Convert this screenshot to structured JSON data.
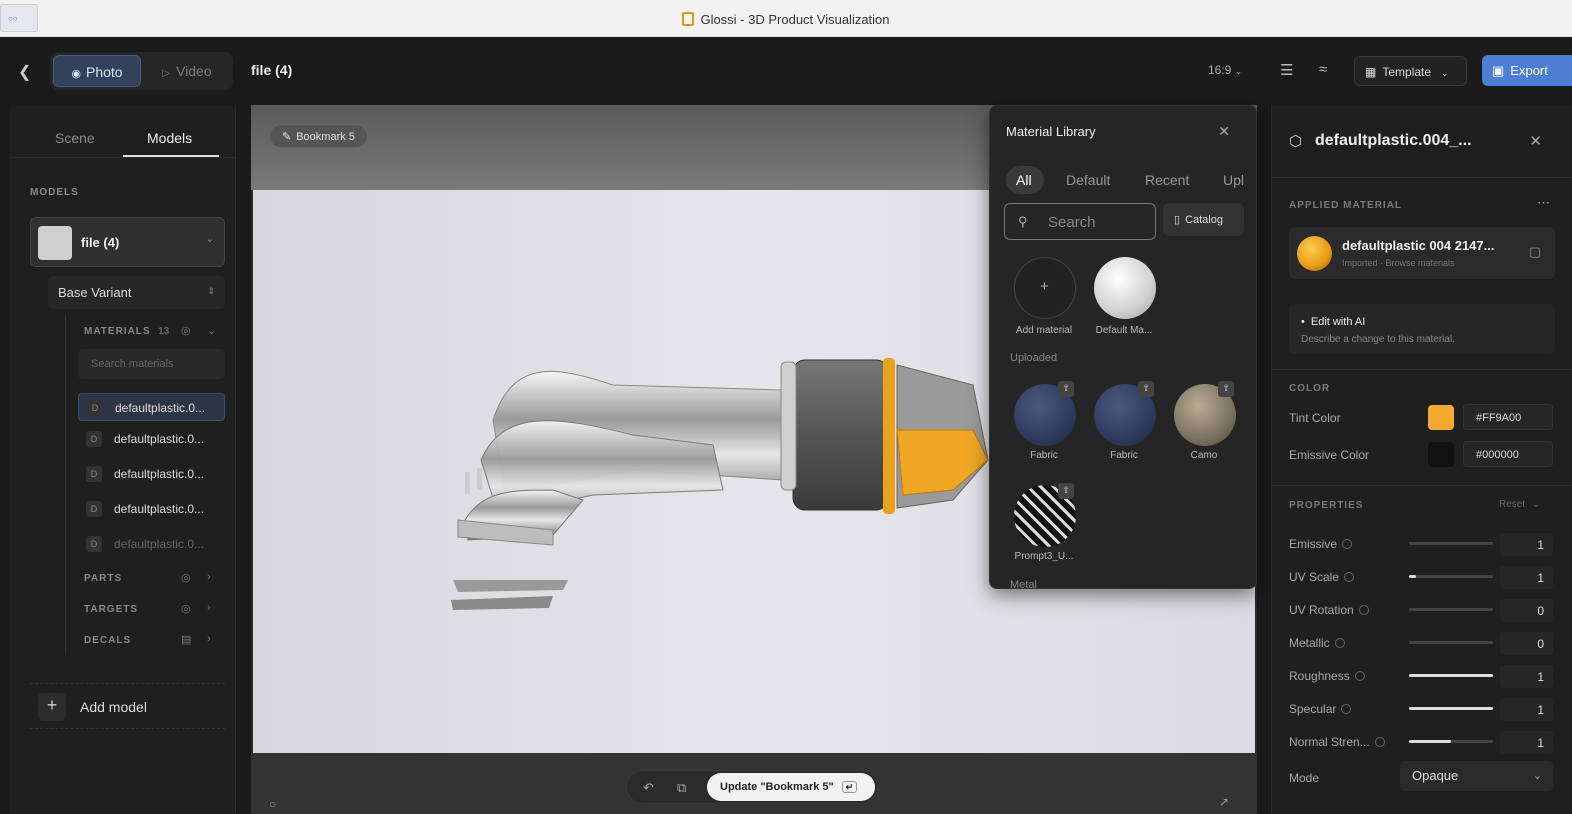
{
  "window": {
    "title": "Glossi - 3D Product Visualization"
  },
  "toolbar": {
    "back_icon": "chevron-left-icon",
    "photo_label": "Photo",
    "video_label": "Video",
    "file_title": "file (4)",
    "aspect_ratio": "16:9",
    "template_label": "Template",
    "export_label": "Export"
  },
  "left_panel": {
    "tabs": [
      "Scene",
      "Models"
    ],
    "active_tab": "Models",
    "models_heading": "MODELS",
    "model_name": "file (4)",
    "variant": "Base Variant",
    "materials_heading": "MATERIALS",
    "materials_count": "13",
    "search_placeholder": "Search materials",
    "materials": [
      {
        "badge": "D",
        "name": "defaultplastic.0..."
      },
      {
        "badge": "D",
        "name": "defaultplastic.0..."
      },
      {
        "badge": "D",
        "name": "defaultplastic.0..."
      },
      {
        "badge": "D",
        "name": "defaultplastic.0..."
      },
      {
        "badge": "D",
        "name": "defaultplastic.0..."
      }
    ],
    "parts_heading": "PARTS",
    "targets_heading": "TARGETS",
    "decals_heading": "DECALS",
    "add_model_label": "Add model"
  },
  "viewport": {
    "bookmark_label": "Bookmark 5",
    "update_button_label": "Update \"Bookmark 5\""
  },
  "material_library": {
    "title": "Material Library",
    "tabs": [
      "All",
      "Default",
      "Recent",
      "Upl"
    ],
    "search_placeholder": "Search",
    "catalog_label": "Catalog",
    "add_material_label": "Add material",
    "default_material_label": "Default Ma...",
    "uploaded_heading": "Uploaded",
    "uploaded": [
      {
        "label": "Fabric"
      },
      {
        "label": "Fabric"
      },
      {
        "label": "Camo"
      },
      {
        "label": "Prompt3_U..."
      }
    ],
    "metal_heading": "Metal"
  },
  "right_panel": {
    "title": "defaultplastic.004_...",
    "applied_heading": "APPLIED MATERIAL",
    "material_name": "defaultplastic 004 2147...",
    "material_sub": "Imported · Browse materials",
    "ai_title": "Edit with AI",
    "ai_desc": "Describe a change to this material.",
    "color_heading": "COLOR",
    "tint_label": "Tint Color",
    "tint_hex": "#FF9A00",
    "emissive_color_label": "Emissive Color",
    "emissive_hex": "#000000",
    "properties_heading": "PROPERTIES",
    "reset_label": "Reset",
    "properties": [
      {
        "label": "Emissive",
        "value": "1",
        "fill": 0.0
      },
      {
        "label": "UV Scale",
        "value": "1",
        "fill": 0.08
      },
      {
        "label": "UV Rotation",
        "value": "0",
        "fill": 0.0
      },
      {
        "label": "Metallic",
        "value": "0",
        "fill": 0.0
      },
      {
        "label": "Roughness",
        "value": "1",
        "fill": 1.0
      },
      {
        "label": "Specular",
        "value": "1",
        "fill": 1.0
      },
      {
        "label": "Normal Stren...",
        "value": "1",
        "fill": 0.5
      }
    ],
    "mode_label": "Mode",
    "mode_value": "Opaque"
  },
  "colors": {
    "accent": "#4a7fd4",
    "tint": "#FF9A00",
    "emissive": "#000000"
  }
}
